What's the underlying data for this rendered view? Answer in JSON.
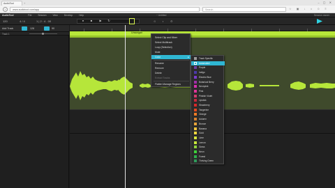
{
  "browser": {
    "tab_title": "AudioTool",
    "url": "www.audiotool.com/app",
    "search_placeholder": "Search",
    "new_tab_symbol": "+",
    "window_controls": "– ▢ ✕",
    "back_symbol": "‹",
    "toolbar_icons": "☆ ▣ ↓ ⌂ ☺ ≡"
  },
  "app": {
    "name": "AudioTool",
    "menus": [
      "File",
      "Session",
      "View",
      "Develop",
      "Help"
    ],
    "document_title": "~ Untitled",
    "user": "Session owner"
  },
  "transport": {
    "tempo": "120",
    "signature": "4 / 4",
    "time": "1 | 2 : 4 . 00",
    "icons": "⊙ ◐ ⚙"
  },
  "left_panel": {
    "add_track": "Add Track",
    "toggle_a": "",
    "label_a": "128",
    "toggle_b": "",
    "label_b": "90",
    "track_label": "Track 1"
  },
  "editor": {
    "clip_label": "Unsongsn"
  },
  "context_menu": {
    "items": [
      {
        "label": "Select Clip and Mixer",
        "state": "normal"
      },
      {
        "label": "Select Multitrack",
        "state": "normal"
      },
      {
        "label": "Loop (Selection)",
        "state": "normal"
      },
      {
        "label": "Mute",
        "state": "normal"
      },
      {
        "label": "Color",
        "state": "selected"
      },
      {
        "label": "Rename",
        "state": "normal"
      },
      {
        "label": "Remove",
        "state": "normal"
      },
      {
        "label": "Delete",
        "state": "normal"
      },
      {
        "label": "Extract Tracks",
        "state": "dim"
      },
      {
        "label": "Flatten Manage Regions",
        "state": "normal"
      }
    ],
    "submenu_arrow": "▸"
  },
  "color_submenu": {
    "items": [
      {
        "label": "Track Specific",
        "color": "#9a9a9a"
      },
      {
        "label": "Automated",
        "color": "#2fb6d3"
      },
      {
        "label": "Purple",
        "color": "#6b3fa0"
      },
      {
        "label": "Indigo",
        "color": "#4b3aa8"
      },
      {
        "label": "Electric Blue",
        "color": "#7a3ccf"
      },
      {
        "label": "Botanical Berry",
        "color": "#a02fa8"
      },
      {
        "label": "Neonpink",
        "color": "#d62fb0"
      },
      {
        "label": "Pink",
        "color": "#e0359a"
      },
      {
        "label": "Pinkish Violet",
        "color": "#d13a6e"
      },
      {
        "label": "Lipstick",
        "color": "#c8283c"
      },
      {
        "label": "Strawberry",
        "color": "#d6282a"
      },
      {
        "label": "Tangerine",
        "color": "#e34a1f"
      },
      {
        "label": "Orange",
        "color": "#ef7a24"
      },
      {
        "label": "Autumn",
        "color": "#d9822e"
      },
      {
        "label": "Bronze",
        "color": "#e7a43a"
      },
      {
        "label": "Banana",
        "color": "#f0c43c"
      },
      {
        "label": "Gold",
        "color": "#eed83e"
      },
      {
        "label": "Lime",
        "color": "#d6e63a"
      },
      {
        "label": "Lemon",
        "color": "#c7e63a"
      },
      {
        "label": "Grass",
        "color": "#8fd13a"
      },
      {
        "label": "Neon",
        "color": "#3ed23a"
      },
      {
        "label": "Forest",
        "color": "#2fae4a"
      },
      {
        "label": "Thriving Green",
        "color": "#2f9a5a"
      }
    ]
  },
  "colors": {
    "accent": "#2fb6d3",
    "clip": "#b7e63a",
    "waveform": "#b6e63a"
  }
}
